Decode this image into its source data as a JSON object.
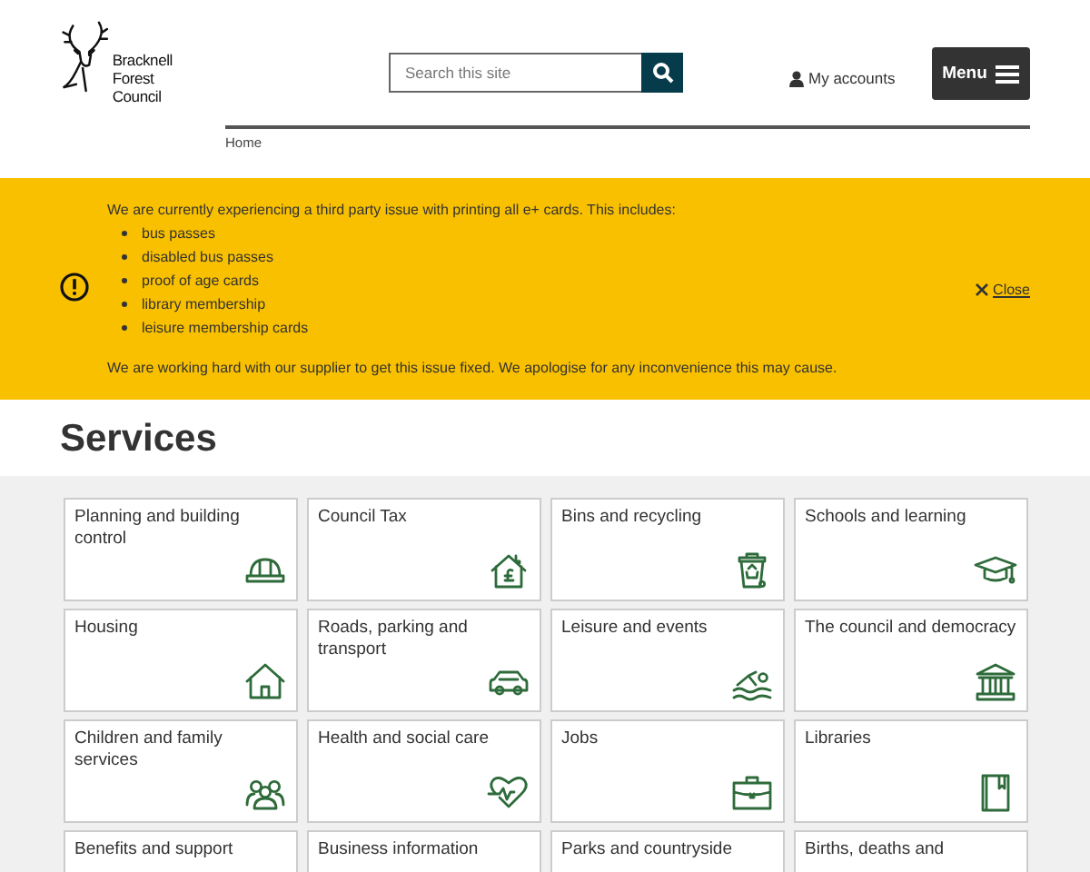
{
  "header": {
    "logo_text": [
      "Bracknell",
      "Forest",
      "Council"
    ],
    "search": {
      "placeholder": "Search this site"
    },
    "account_link": "My accounts",
    "menu_button": "Menu"
  },
  "breadcrumb": [
    "Home"
  ],
  "alert": {
    "intro": "We are currently experiencing a third party issue with printing all e+ cards. This includes:",
    "items": [
      "bus passes",
      "disabled bus passes",
      "proof of age cards",
      "library membership",
      "leisure membership cards"
    ],
    "outro": "We are working hard with our supplier to get this issue fixed. We apologise for any inconvenience this may cause.",
    "close": "Close"
  },
  "services": {
    "title": "Services",
    "tiles": [
      {
        "label": "Planning and building control"
      },
      {
        "label": "Council Tax"
      },
      {
        "label": "Bins and recycling"
      },
      {
        "label": "Schools and learning"
      },
      {
        "label": "Housing"
      },
      {
        "label": "Roads, parking and transport"
      },
      {
        "label": "Leisure and events"
      },
      {
        "label": "The council and democracy"
      },
      {
        "label": "Children and family services"
      },
      {
        "label": "Health and social care"
      },
      {
        "label": "Jobs"
      },
      {
        "label": "Libraries"
      },
      {
        "label": "Benefits and support"
      },
      {
        "label": "Business information"
      },
      {
        "label": "Parks and countryside"
      },
      {
        "label": "Births, deaths and"
      }
    ]
  }
}
